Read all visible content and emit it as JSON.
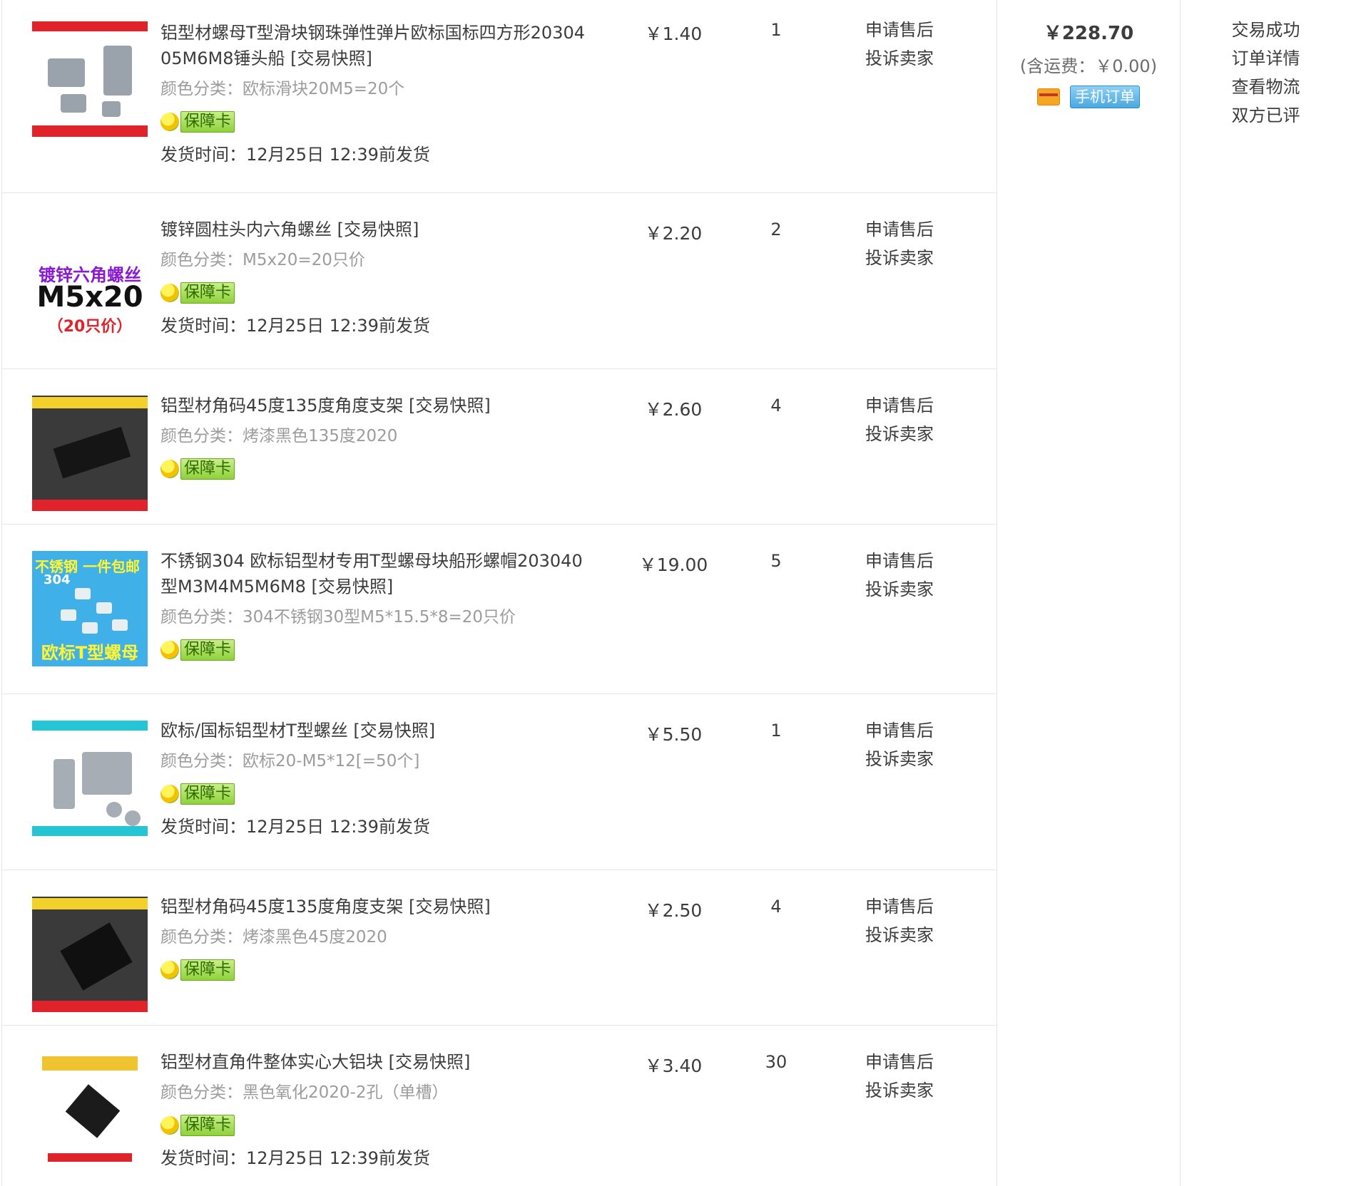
{
  "items": [
    {
      "title": "铝型材螺母T型滑块钢珠弹性弹片欧标国标四方形20304 05M6M8锤头船 [交易快照]",
      "sku_label": "颜色分类：",
      "sku_value": "欧标滑块20M5=20个",
      "guarantee": "保障卡",
      "ship": "发货时间：12月25日 12:39前发货",
      "price": "￥1.40",
      "qty": "1",
      "op1": "申请售后",
      "op2": "投诉卖家"
    },
    {
      "title": "镀锌圆柱头内六角螺丝 [交易快照]",
      "sku_label": "颜色分类：",
      "sku_value": "M5x20=20只价",
      "guarantee": "保障卡",
      "ship": "发货时间：12月25日 12:39前发货",
      "price": "￥2.20",
      "qty": "2",
      "op1": "申请售后",
      "op2": "投诉卖家",
      "thumb_text": [
        "镀锌六角螺丝",
        "M5x20",
        "（20只价）"
      ]
    },
    {
      "title": "铝型材角码45度135度角度支架 [交易快照]",
      "sku_label": "颜色分类：",
      "sku_value": "烤漆黑色135度2020",
      "guarantee": "保障卡",
      "price": "￥2.60",
      "qty": "4",
      "op1": "申请售后",
      "op2": "投诉卖家"
    },
    {
      "title": "不锈钢304 欧标铝型材专用T型螺母块船形螺帽203040型M3M4M5M6M8 [交易快照]",
      "sku_label": "颜色分类：",
      "sku_value": "304不锈钢30型M5*15.5*8=20只价",
      "guarantee": "保障卡",
      "price": "￥19.00",
      "qty": "5",
      "op1": "申请售后",
      "op2": "投诉卖家",
      "thumb_text": [
        "不锈钢 一件包邮",
        "304",
        "欧标T型螺母"
      ]
    },
    {
      "title": "欧标/国标铝型材T型螺丝 [交易快照]",
      "sku_label": "颜色分类：",
      "sku_value": "欧标20-M5*12[=50个]",
      "guarantee": "保障卡",
      "ship": "发货时间：12月25日 12:39前发货",
      "price": "￥5.50",
      "qty": "1",
      "op1": "申请售后",
      "op2": "投诉卖家"
    },
    {
      "title": "铝型材角码45度135度角度支架 [交易快照]",
      "sku_label": "颜色分类：",
      "sku_value": "烤漆黑色45度2020",
      "guarantee": "保障卡",
      "price": "￥2.50",
      "qty": "4",
      "op1": "申请售后",
      "op2": "投诉卖家"
    },
    {
      "title": "铝型材直角件整体实心大铝块 [交易快照]",
      "sku_label": "颜色分类：",
      "sku_value": "黑色氧化2020-2孔（单槽）",
      "guarantee": "保障卡",
      "ship": "发货时间：12月25日 12:39前发货",
      "price": "￥3.40",
      "qty": "30",
      "op1": "申请售后",
      "op2": "投诉卖家"
    }
  ],
  "order": {
    "total": "￥228.70",
    "shipping": "(含运费：￥0.00)",
    "mobile_badge": "手机订单",
    "status": [
      "交易成功",
      "订单详情",
      "查看物流",
      "双方已评"
    ]
  }
}
